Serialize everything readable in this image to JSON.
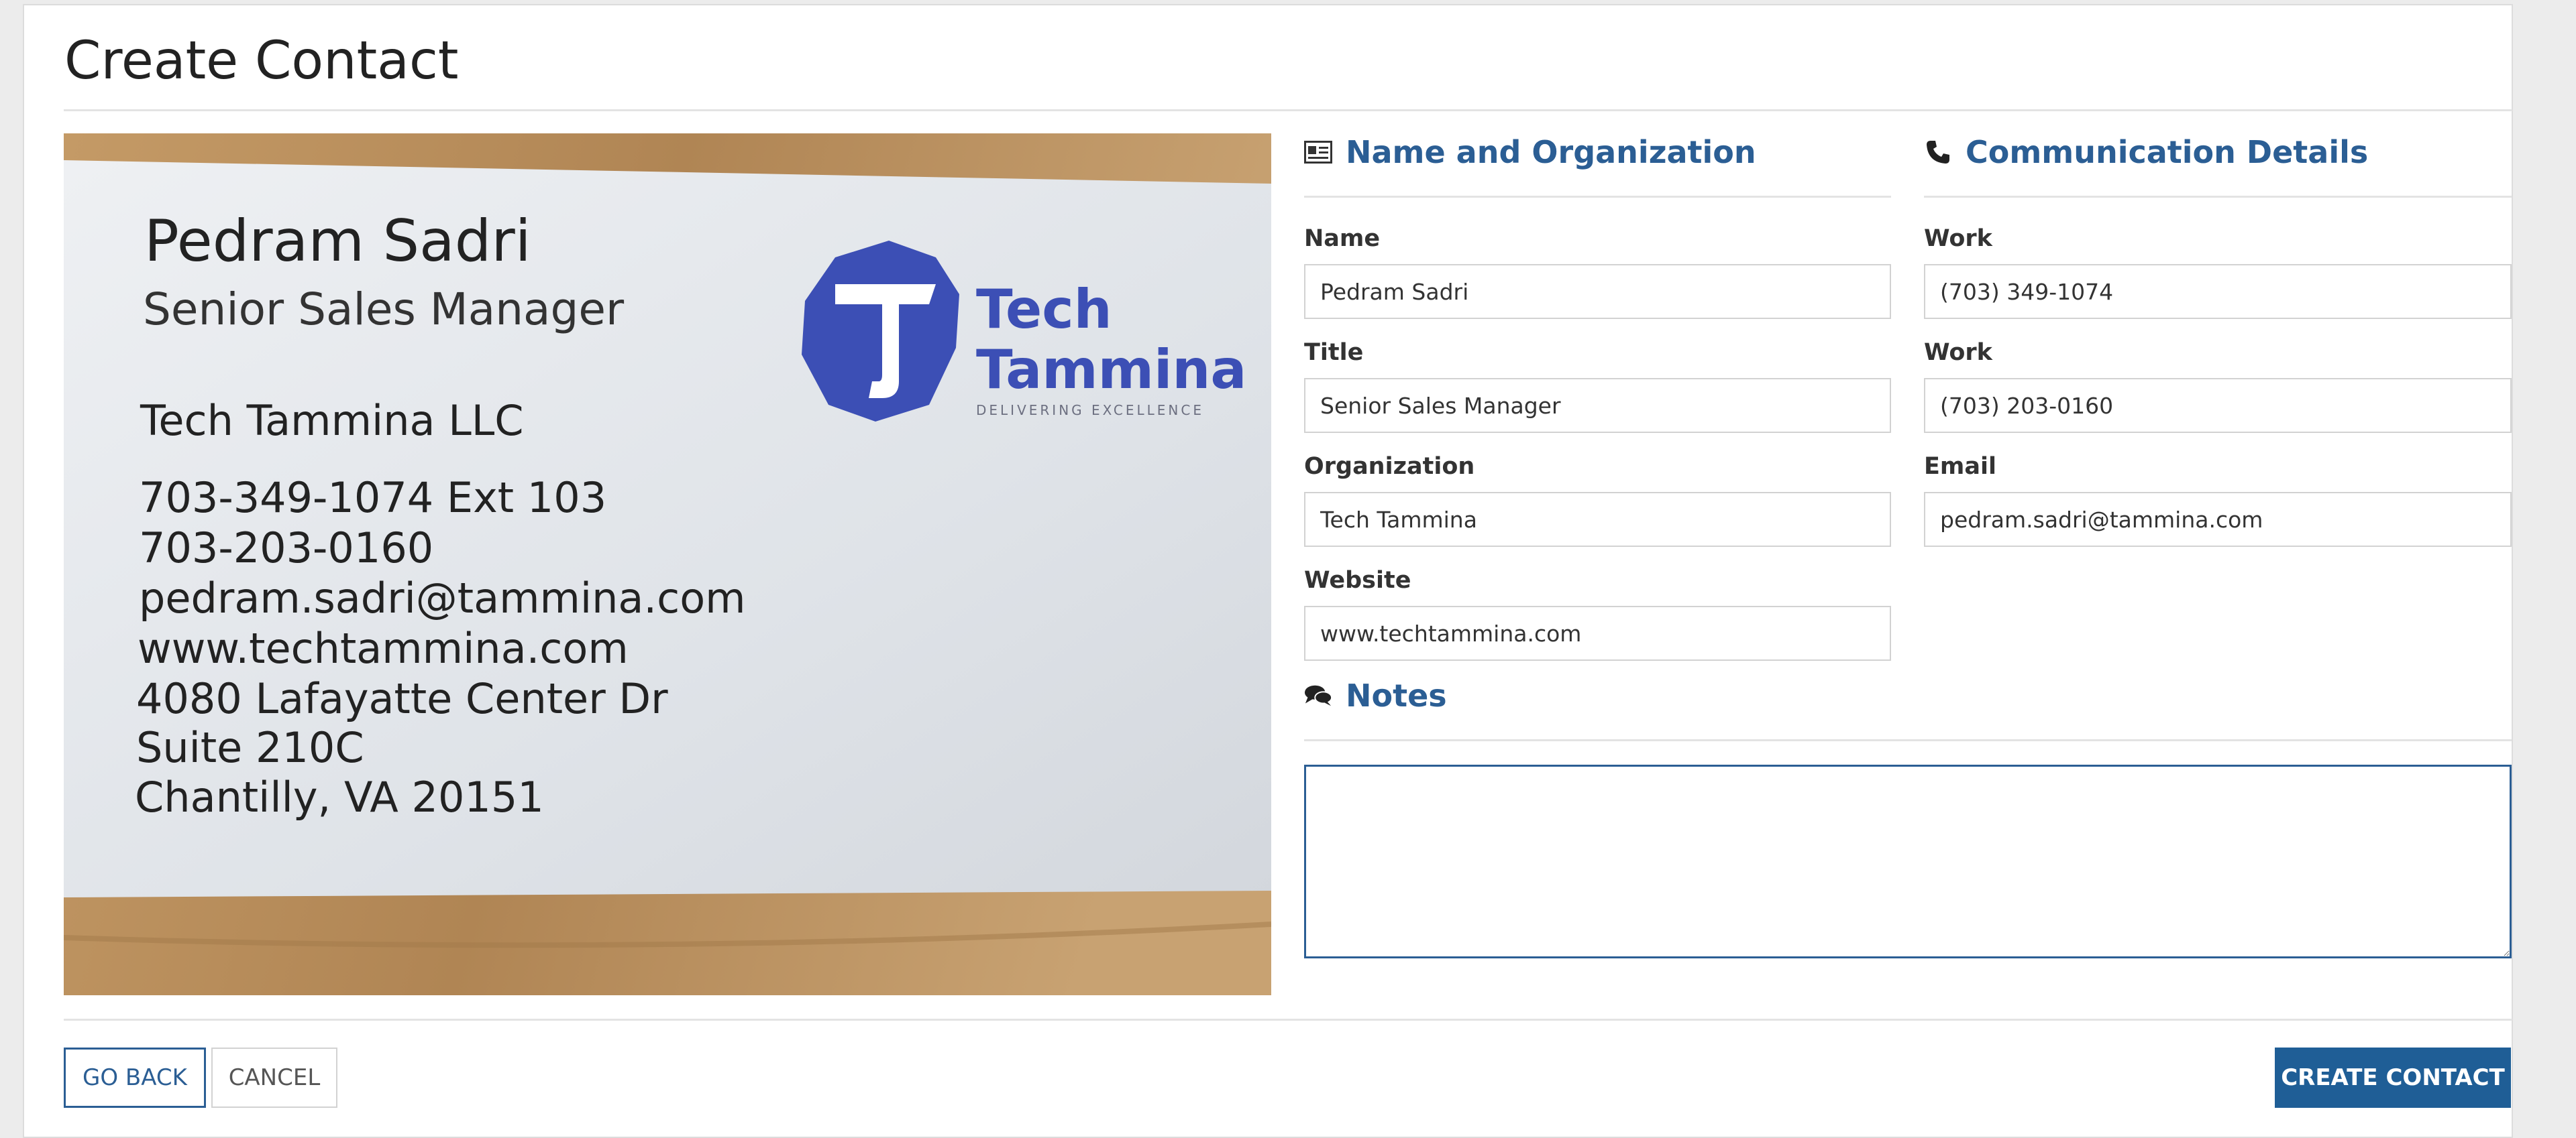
{
  "page": {
    "title": "Create Contact"
  },
  "card": {
    "name": "Pedram Sadri",
    "title": "Senior Sales Manager",
    "company": "Tech Tammina LLC",
    "phone1": "703-349-1074 Ext 103",
    "phone2": "703-203-0160",
    "email": "pedram.sadri@tammina.com",
    "website": "www.techtammina.com",
    "address1": "4080 Lafayatte Center Dr",
    "address2": "Suite 210C",
    "address3": "Chantilly, VA 20151",
    "logo_word1": "Tech",
    "logo_word2": "Tammina",
    "logo_tagline": "DELIVERING EXCELLENCE"
  },
  "name_org": {
    "heading": "Name and Organization",
    "icon": "id-card-icon",
    "name_label": "Name",
    "name_value": "Pedram Sadri",
    "title_label": "Title",
    "title_value": "Senior Sales Manager",
    "org_label": "Organization",
    "org_value": "Tech Tammina",
    "website_label": "Website",
    "website_value": "www.techtammina.com"
  },
  "comm": {
    "heading": "Communication Details",
    "icon": "phone-icon",
    "work1_label": "Work",
    "work1_value": "(703) 349-1074",
    "work2_label": "Work",
    "work2_value": "(703) 203-0160",
    "email_label": "Email",
    "email_value": "pedram.sadri@tammina.com"
  },
  "notes": {
    "heading": "Notes",
    "icon": "comments-icon",
    "value": ""
  },
  "actions": {
    "go_back": "GO BACK",
    "cancel": "CANCEL",
    "create": "CREATE CONTACT"
  },
  "colors": {
    "accent": "#2b5e94",
    "primary_button": "#1f5e96"
  }
}
